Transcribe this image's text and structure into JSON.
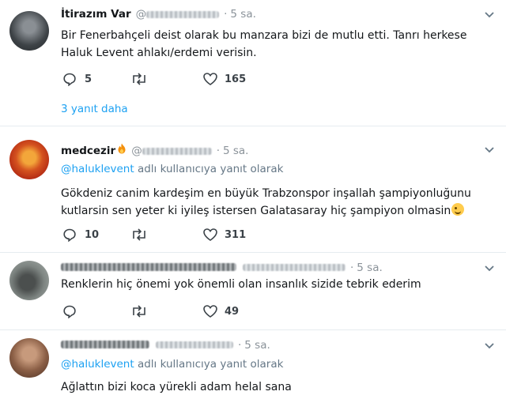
{
  "tweets": [
    {
      "name": "İtirazım Var",
      "handle_prefix": "@",
      "time": "5 sa.",
      "text": "Bir Fenerbahçeli deist olarak bu manzara bizi de mutlu etti. Tanrı herkese Haluk Levent ahlakı/erdemi verisin.",
      "replies": "5",
      "retweets": "",
      "likes": "165",
      "more_replies": "3 yanıt daha"
    },
    {
      "name": "medcezir",
      "name_emoji": "fire-icon",
      "handle_prefix": "@",
      "time": "5 sa.",
      "replying_mention": "@haluklevent",
      "replying_suffix": " adlı kullanıcıya yanıt olarak",
      "text_line1": "Gökdeniz canim kardeşim en büyük Trabzonspor inşallah şampiyonluğunu",
      "text_line2": "kutlarsin sen yeter ki iyileş istersen Galatasaray hiç şampiyon olmasin",
      "text_emoji": "winking-face-icon",
      "replies": "10",
      "retweets": "",
      "likes": "311"
    },
    {
      "time": "5 sa.",
      "text": "Renklerin hiç önemi yok önemli olan insanlık sizide tebrik ederim",
      "replies": "",
      "retweets": "",
      "likes": "49"
    },
    {
      "time": "5 sa.",
      "replying_mention": "@haluklevent",
      "replying_suffix": " adlı kullanıcıya yanıt olarak",
      "text": "Ağlattın bizi koca yürekli adam helal sana"
    }
  ],
  "colors": {
    "link": "#1da1f2",
    "muted": "#657786",
    "divider": "#e6ecf0"
  }
}
